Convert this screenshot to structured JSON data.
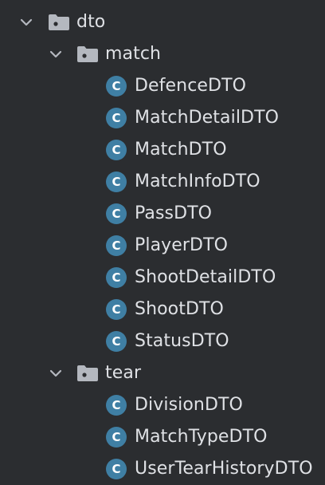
{
  "tree": {
    "root": {
      "label": "dto",
      "expanded": true,
      "icon": "folder-icon"
    },
    "match": {
      "label": "match",
      "expanded": true,
      "icon": "folder-icon",
      "items": [
        "DefenceDTO",
        "MatchDetailDTO",
        "MatchDTO",
        "MatchInfoDTO",
        "PassDTO",
        "PlayerDTO",
        "ShootDetailDTO",
        "ShootDTO",
        "StatusDTO"
      ]
    },
    "tear": {
      "label": "tear",
      "expanded": true,
      "icon": "folder-icon",
      "items": [
        "DivisionDTO",
        "MatchTypeDTO",
        "UserTearHistoryDTO"
      ]
    },
    "class_icon_glyph": "C",
    "colors": {
      "background": "#2b2d30",
      "text": "#dfe1e5",
      "class_icon": "#3f7fa4",
      "folder": "#b4b8bf"
    }
  }
}
